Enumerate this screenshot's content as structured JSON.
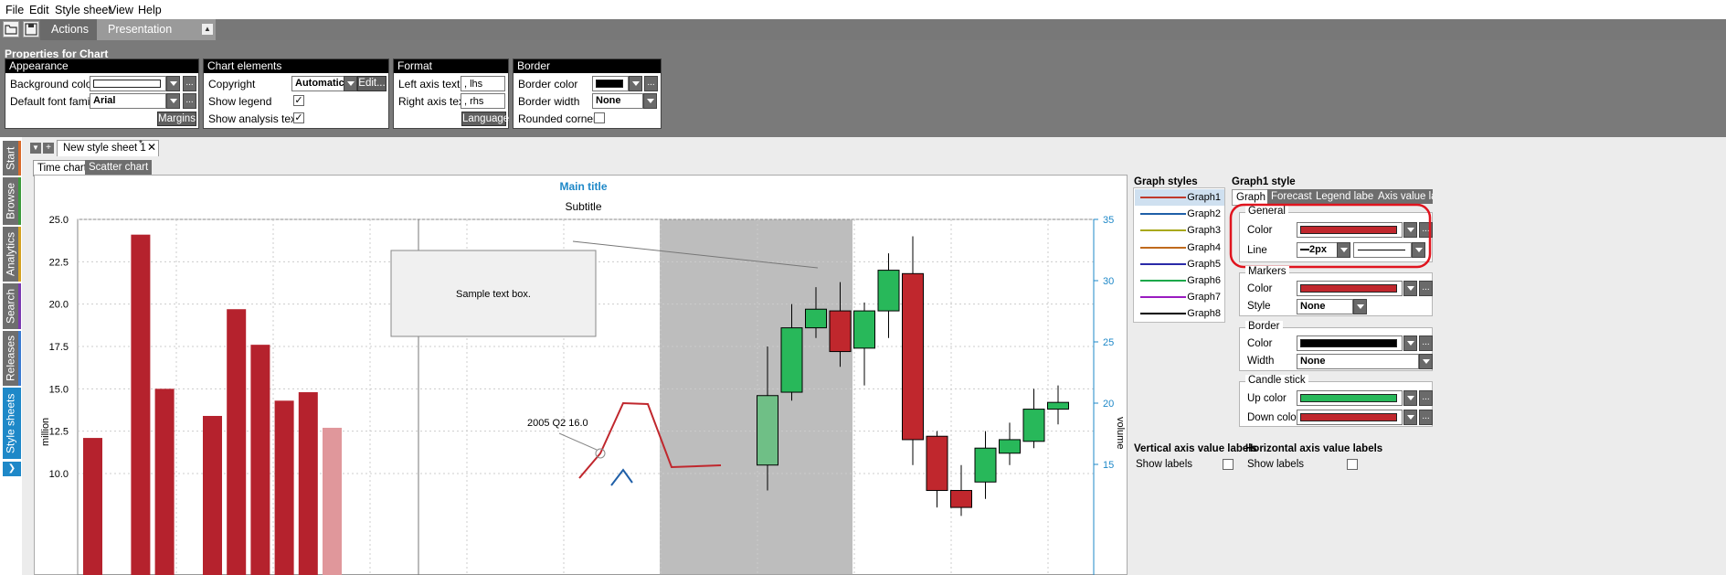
{
  "menu": [
    "File",
    "Edit",
    "Style sheet",
    "View",
    "Help"
  ],
  "toolbar": {
    "tabs": [
      "Actions",
      "Presentation properties"
    ]
  },
  "ribbon": {
    "title": "Properties for Chart",
    "appearance": {
      "header": "Appearance",
      "bg_label": "Background color",
      "font_label": "Default font family",
      "font_value": "Arial",
      "margins": "Margins"
    },
    "chart_elements": {
      "header": "Chart elements",
      "copyright_label": "Copyright",
      "copyright_value": "Automatic",
      "edit": "Edit...",
      "legend_label": "Show legend",
      "analysis_label": "Show analysis texts"
    },
    "format": {
      "header": "Format",
      "left_label": "Left axis text",
      "left_value": ", lhs",
      "right_label": "Right axis text",
      "right_value": ", rhs",
      "language": "Language"
    },
    "border": {
      "header": "Border",
      "color_label": "Border color",
      "width_label": "Border width",
      "width_value": "None",
      "rounded_label": "Rounded corners"
    }
  },
  "left_tabs": [
    "Start",
    "Browse",
    "Analytics",
    "Search",
    "Releases",
    "Style sheets"
  ],
  "doc": {
    "tab": "New style sheet 1",
    "modified": "*",
    "subtabs": [
      "Time chart",
      "Scatter chart"
    ]
  },
  "chart_data": {
    "type": "bar",
    "title": "Main title",
    "subtitle": "Subtitle",
    "ylabel": "million",
    "y2label": "volume",
    "left_ticks": [
      "25.0",
      "22.5",
      "20.0",
      "17.5",
      "15.0",
      "12.5",
      "10.0"
    ],
    "right_ticks": [
      "35",
      "30",
      "25",
      "20",
      "15"
    ],
    "ylim": [
      10,
      25
    ],
    "y2lim": [
      15,
      35
    ],
    "bars": [
      12.1,
      null,
      24.1,
      15.0,
      null,
      13.4,
      19.7,
      17.6,
      14.3,
      14.8,
      12.7
    ],
    "candles": [
      {
        "o": 10.5,
        "c": 14.6,
        "h": 17.5,
        "l": 9.0,
        "up": true
      },
      {
        "o": 14.8,
        "c": 18.6,
        "h": 20.0,
        "l": 14.3,
        "up": true
      },
      {
        "o": 18.6,
        "c": 19.7,
        "h": 21.0,
        "l": 18.0,
        "up": true
      },
      {
        "o": 19.6,
        "c": 17.2,
        "h": 21.3,
        "l": 16.3,
        "up": false
      },
      {
        "o": 17.4,
        "c": 19.6,
        "h": 20.1,
        "l": 15.2,
        "up": true
      },
      {
        "o": 19.6,
        "c": 22.0,
        "h": 23.0,
        "l": 18.0,
        "up": true
      },
      {
        "o": 21.8,
        "c": 12.0,
        "h": 24.0,
        "l": 10.5,
        "up": false
      },
      {
        "o": 12.2,
        "c": 9.0,
        "h": 12.5,
        "l": 8.0,
        "up": false
      },
      {
        "o": 9.0,
        "c": 8.0,
        "h": 10.5,
        "l": 7.5,
        "up": false
      },
      {
        "o": 9.5,
        "c": 11.5,
        "h": 12.5,
        "l": 8.5,
        "up": true
      },
      {
        "o": 11.2,
        "c": 12.0,
        "h": 13.0,
        "l": 10.5,
        "up": true
      },
      {
        "o": 11.9,
        "c": 13.8,
        "h": 15.0,
        "l": 11.5,
        "up": true
      },
      {
        "o": 13.8,
        "c": 14.2,
        "h": 15.2,
        "l": 12.9,
        "up": true
      }
    ],
    "textbox": "Sample text box.",
    "annotation": "2005 Q2 16.0"
  },
  "graph_styles": {
    "header": "Graph styles",
    "items": [
      {
        "label": "Graph1",
        "color": "#c0392b"
      },
      {
        "label": "Graph2",
        "color": "#1f5fa8"
      },
      {
        "label": "Graph3",
        "color": "#a8a81c"
      },
      {
        "label": "Graph4",
        "color": "#c06a1c"
      },
      {
        "label": "Graph5",
        "color": "#2a2aa8"
      },
      {
        "label": "Graph6",
        "color": "#1ca84a"
      },
      {
        "label": "Graph7",
        "color": "#9a1cc0"
      },
      {
        "label": "Graph8",
        "color": "#000000"
      }
    ]
  },
  "graph1_style": {
    "header": "Graph1 style",
    "tabs": [
      "Graph",
      "Forecast",
      "Legend label",
      "Axis value lab"
    ],
    "general": "General",
    "color": "Color",
    "line": "Line",
    "line_value": "2px",
    "markers": "Markers",
    "style": "Style",
    "style_value": "None",
    "border": "Border",
    "width": "Width",
    "width_value": "None",
    "candle": "Candle stick",
    "up_color": "Up color",
    "down_color": "Down color"
  },
  "axis_labels": {
    "vertical": "Vertical axis value labels",
    "horizontal": "Horizontal axis value labels",
    "show": "Show labels"
  },
  "colors": {
    "bar": "#b5222d",
    "up": "#28b85a",
    "down": "#c0272d",
    "accent": "#1e88c8"
  }
}
